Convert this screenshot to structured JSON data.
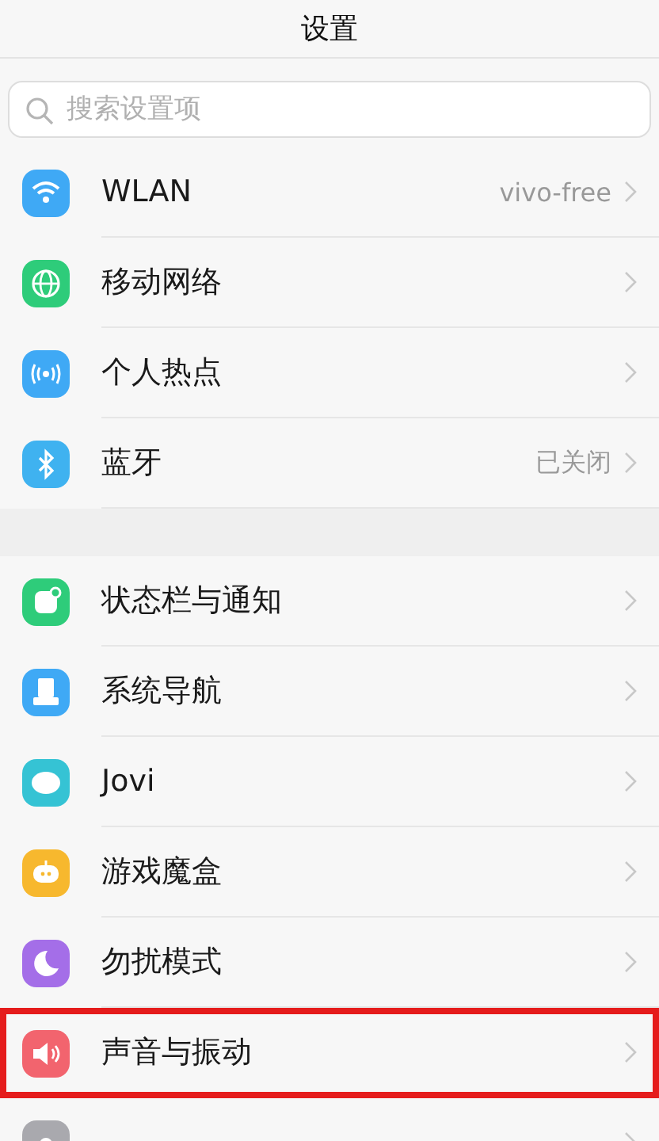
{
  "header": {
    "title": "设置"
  },
  "search": {
    "placeholder": "搜索设置项"
  },
  "groups": [
    {
      "items": [
        {
          "label": "WLAN",
          "value": "vivo-free",
          "color": "#3fa9f5",
          "highlighted": false
        },
        {
          "label": "移动网络",
          "color": "#2ecc7a",
          "highlighted": false
        },
        {
          "label": "个人热点",
          "color": "#3fa9f5",
          "highlighted": false
        },
        {
          "label": "蓝牙",
          "value": "已关闭",
          "color": "#3fb2f0",
          "highlighted": false
        }
      ]
    },
    {
      "items": [
        {
          "label": "状态栏与通知",
          "color": "#2ecc7a",
          "highlighted": false
        },
        {
          "label": "系统导航",
          "color": "#3fa9f5",
          "highlighted": false
        },
        {
          "label": "Jovi",
          "color": "#35c3d4",
          "highlighted": false
        },
        {
          "label": "游戏魔盒",
          "color": "#f7b82e",
          "highlighted": false
        },
        {
          "label": "勿扰模式",
          "color": "#a46ee8",
          "highlighted": false
        },
        {
          "label": "声音与振动",
          "color": "#f2646e",
          "highlighted": true
        },
        {
          "color": "#a9a9ae",
          "highlighted": false
        }
      ]
    }
  ]
}
